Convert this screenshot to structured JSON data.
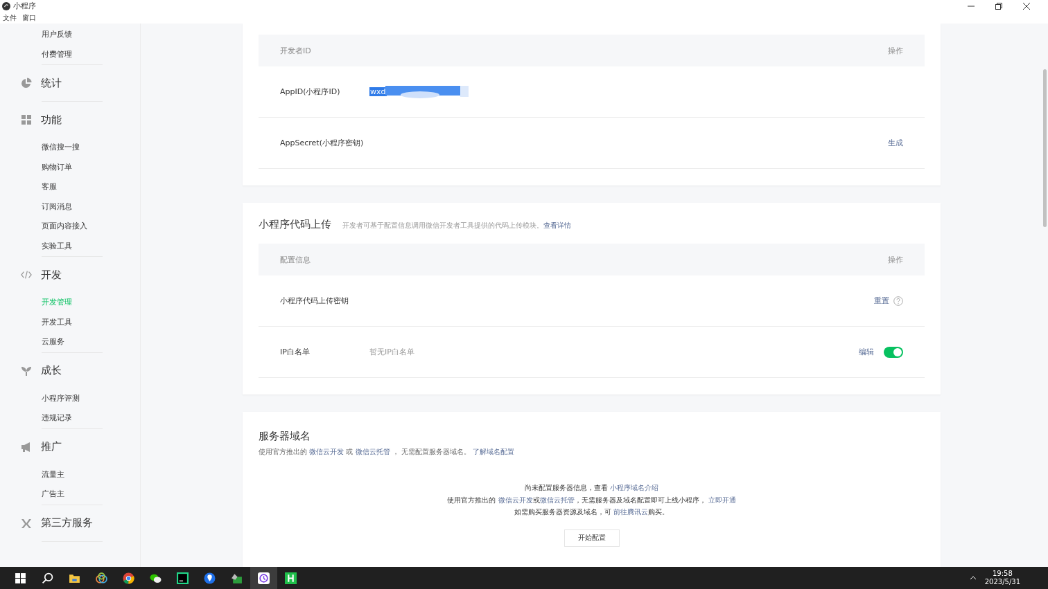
{
  "window": {
    "title": "小程序",
    "menu": [
      "文件",
      "窗口"
    ]
  },
  "sidebar": {
    "groups": [
      {
        "items": [
          {
            "label": "用户反馈",
            "selected": false
          },
          {
            "label": "付费管理",
            "selected": false
          }
        ]
      },
      {
        "title": "统计"
      },
      {
        "title": "功能",
        "items": [
          {
            "label": "微信搜一搜",
            "selected": false
          },
          {
            "label": "购物订单",
            "selected": false
          },
          {
            "label": "客服",
            "selected": false
          },
          {
            "label": "订阅消息",
            "selected": false
          },
          {
            "label": "页面内容接入",
            "selected": false
          },
          {
            "label": "实验工具",
            "selected": false
          }
        ]
      },
      {
        "title": "开发",
        "items": [
          {
            "label": "开发管理",
            "selected": true
          },
          {
            "label": "开发工具",
            "selected": false
          },
          {
            "label": "云服务",
            "selected": false
          }
        ]
      },
      {
        "title": "成长",
        "items": [
          {
            "label": "小程序评测",
            "selected": false
          },
          {
            "label": "违规记录",
            "selected": false
          }
        ]
      },
      {
        "title": "推广",
        "items": [
          {
            "label": "流量主",
            "selected": false
          },
          {
            "label": "广告主",
            "selected": false
          }
        ]
      },
      {
        "title": "第三方服务"
      }
    ]
  },
  "developer_id": {
    "columns": [
      "开发者ID",
      "操作"
    ],
    "rows": [
      {
        "label": "AppID(小程序ID)",
        "value": "wxd",
        "selected_text": true
      },
      {
        "label": "AppSecret(小程序密钥)",
        "action": "生成"
      }
    ]
  },
  "code_upload": {
    "title": "小程序代码上传",
    "description": "开发者可基于配置信息调用微信开发者工具提供的代码上传模块。",
    "link": "查看详情",
    "columns": [
      "配置信息",
      "操作"
    ],
    "rows": [
      {
        "label": "小程序代码上传密钥",
        "action": "重置",
        "help": true
      },
      {
        "label": "IP白名单",
        "value": "暂无IP白名单",
        "action": "编辑",
        "toggle": {
          "on": true
        }
      }
    ]
  },
  "server_domain": {
    "title": "服务器域名",
    "description": [
      {
        "text": "使用官方推出的 "
      },
      {
        "text": "微信云开发",
        "link": true
      },
      {
        "text": " 或 "
      },
      {
        "text": "微信云托管",
        "link": true
      },
      {
        "text": " ， 无需配置服务器域名。 "
      },
      {
        "text": "了解域名配置",
        "link": true
      }
    ],
    "empty_lines": [
      [
        {
          "text": "尚未配置服务器信息，查看 "
        },
        {
          "text": "小程序域名介绍",
          "link": true
        }
      ],
      [
        {
          "text": "使用官方推出的 "
        },
        {
          "text": "微信云开发",
          "link": true
        },
        {
          "text": "或"
        },
        {
          "text": "微信云托管",
          "link": true
        },
        {
          "text": "，无需服务器及域名配置即可上线小程序， "
        },
        {
          "text": "立即开通",
          "link": true
        }
      ],
      [
        {
          "text": "如需购买服务器资源及域名，可 "
        },
        {
          "text": "前往腾讯云",
          "link": true
        },
        {
          "text": "购买。"
        }
      ]
    ],
    "button": "开始配置"
  },
  "taskbar": {
    "time": "19:58",
    "date": "2023/5/31"
  }
}
